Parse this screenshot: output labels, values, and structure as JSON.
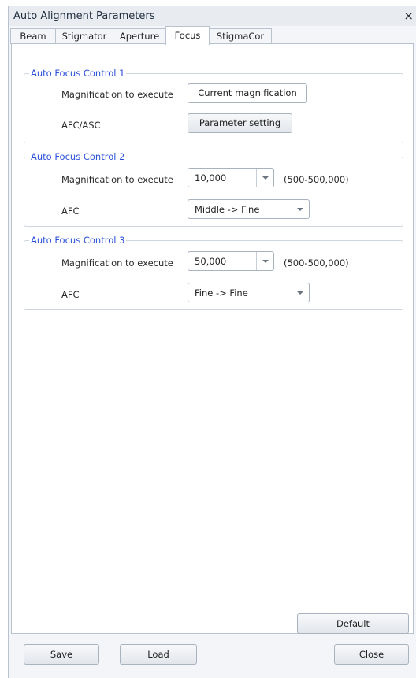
{
  "window": {
    "title": "Auto Alignment Parameters",
    "close_glyph": "×"
  },
  "tabs": [
    {
      "label": "Beam"
    },
    {
      "label": "Stigmator"
    },
    {
      "label": "Aperture"
    },
    {
      "label": "Focus",
      "active": true
    },
    {
      "label": "StigmaCor"
    }
  ],
  "groups": {
    "afc1": {
      "title": "Auto Focus Control 1",
      "mag_label": "Magnification to execute",
      "mag_value": "Current magnification",
      "afc_label": "AFC/ASC",
      "param_button": "Parameter setting"
    },
    "afc2": {
      "title": "Auto Focus Control 2",
      "mag_label": "Magnification to execute",
      "mag_value": "10,000",
      "range": "(500-500,000)",
      "afc_label": "AFC",
      "afc_value": "Middle -> Fine"
    },
    "afc3": {
      "title": "Auto Focus Control 3",
      "mag_label": "Magnification to execute",
      "mag_value": "50,000",
      "range": "(500-500,000)",
      "afc_label": "AFC",
      "afc_value": "Fine -> Fine"
    }
  },
  "buttons": {
    "default": "Default",
    "save": "Save",
    "load": "Load",
    "close": "Close"
  },
  "icons": {
    "dropdown": "chevron-down-icon",
    "close": "close-icon"
  },
  "colors": {
    "group_title": "#2b50d8",
    "window_bg": "#f3f5f8",
    "border": "#b9c3cf"
  }
}
